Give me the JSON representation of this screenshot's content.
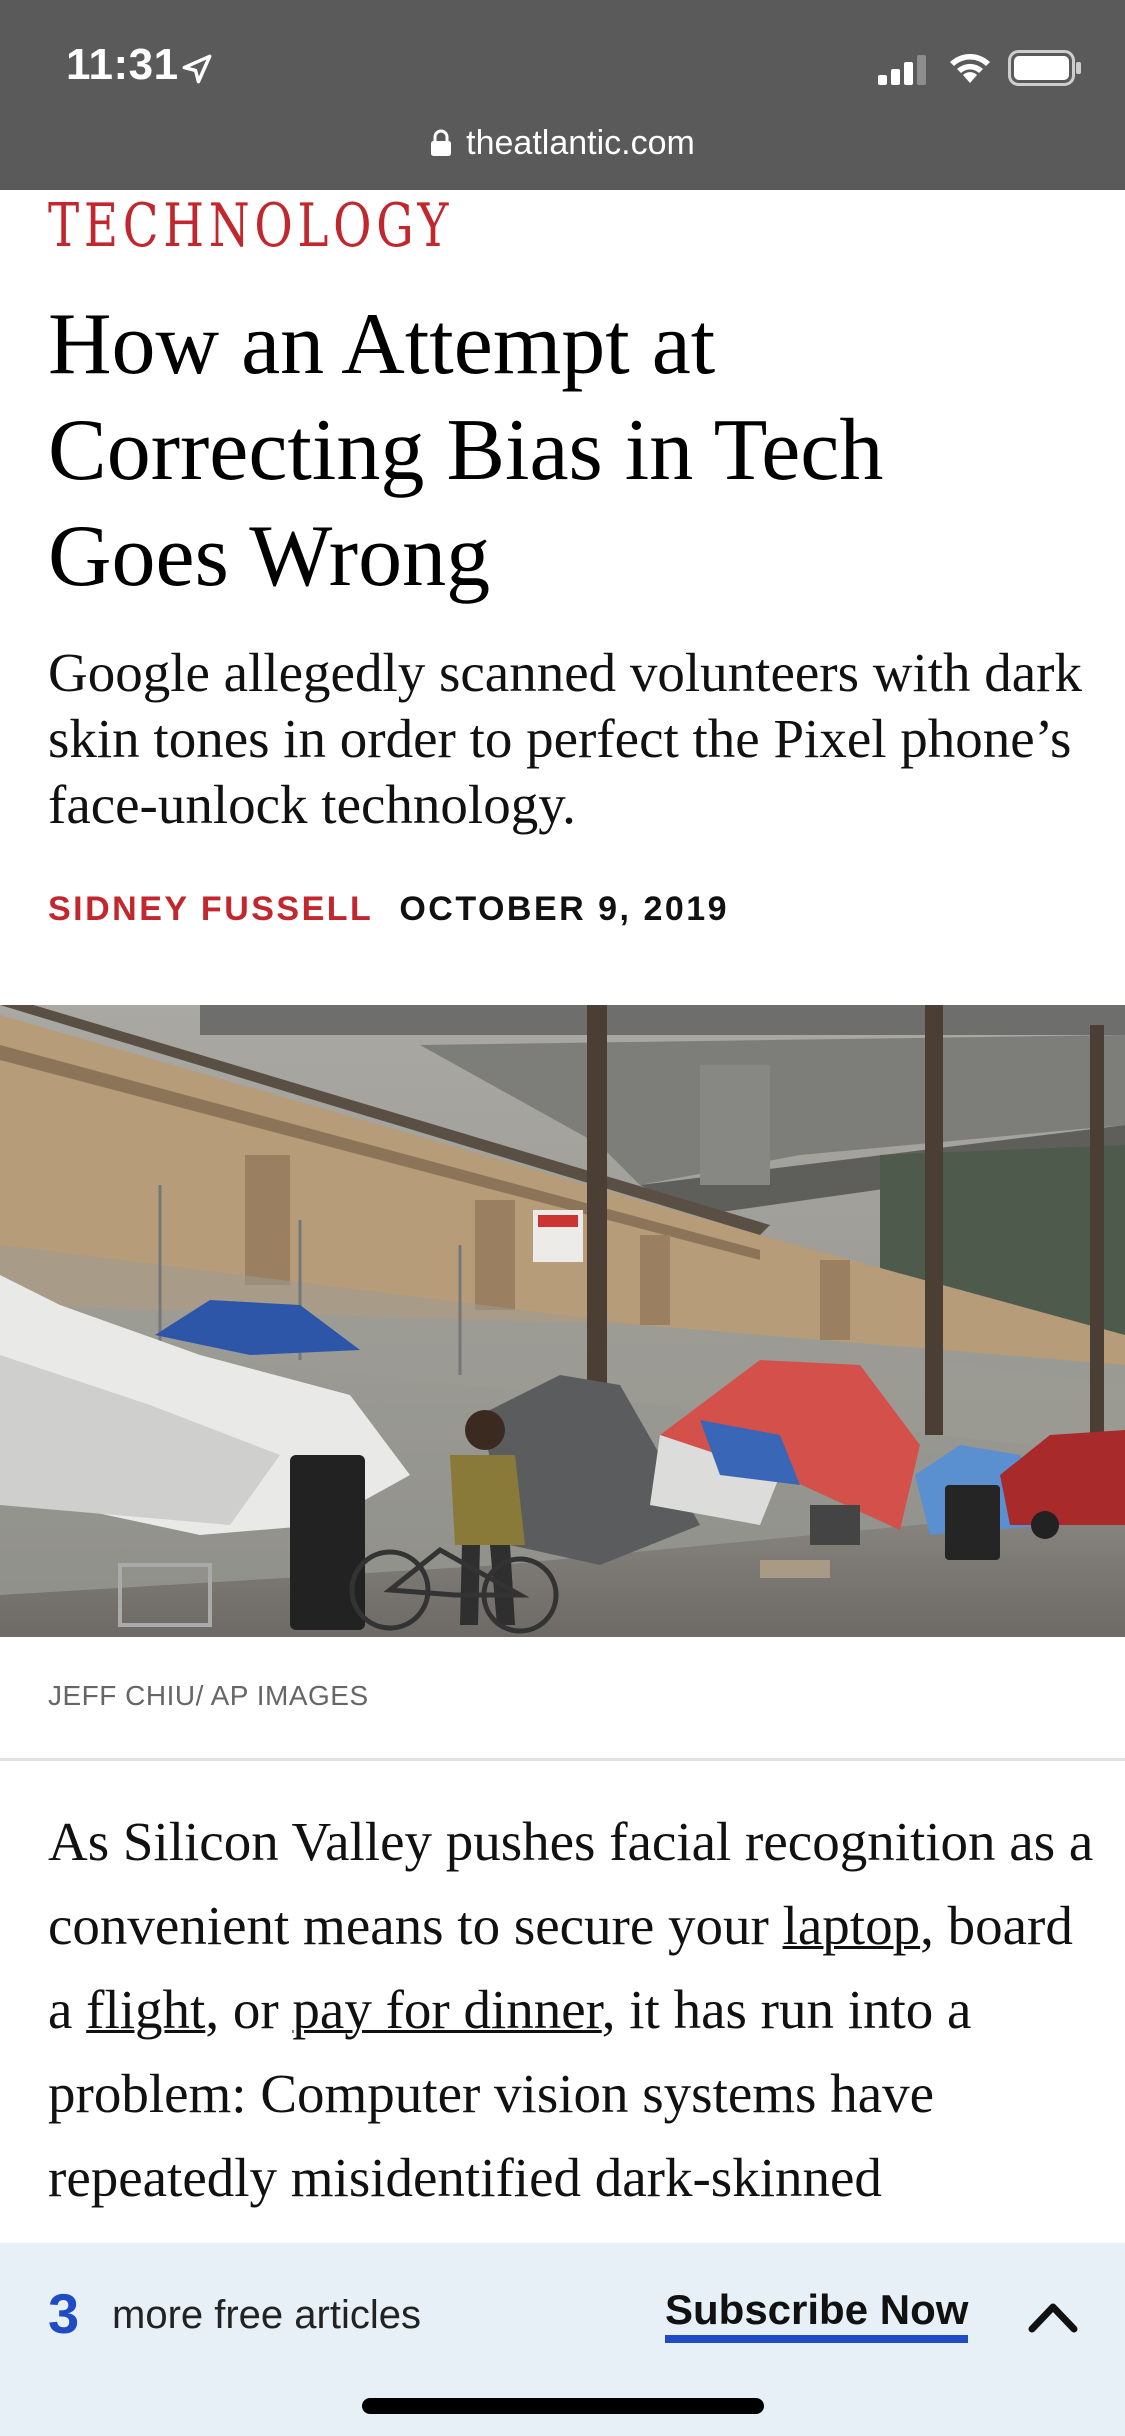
{
  "status_bar": {
    "time": "11:31"
  },
  "browser": {
    "url": "theatlantic.com"
  },
  "article": {
    "section": "TECHNOLOGY",
    "headline": "How an Attempt at Correcting Bias in Tech Goes Wrong",
    "dek": "Google allegedly scanned volunteers with dark skin tones in order to perfect the Pixel phone’s face-unlock technology.",
    "author": "SIDNEY FUSSELL",
    "date": "OCTOBER 9, 2019",
    "photo_credit": "JEFF CHIU/ AP IMAGES",
    "body": {
      "p1_a": "As Silicon Valley pushes facial recognition as a convenient means to secure your ",
      "link_laptop": "laptop",
      "p1_b": ", board a ",
      "link_flight": "flight",
      "p1_c": ", or ",
      "link_dinner": "pay for dinner",
      "p1_d": ", it has run into a problem: Computer vision systems have repeatedly misidentified dark-skinned"
    }
  },
  "paywall": {
    "count": "3",
    "label": "more free articles",
    "subscribe": "Subscribe Now"
  },
  "colors": {
    "accent_red": "#c1272d",
    "accent_blue": "#1f4cc4",
    "chrome_gray": "#5a5a5a",
    "paywall_bg": "#e6f0f6"
  },
  "icons": [
    "location-arrow-icon",
    "cellular-signal-icon",
    "wifi-icon",
    "battery-icon",
    "lock-icon",
    "chevron-up-icon"
  ]
}
